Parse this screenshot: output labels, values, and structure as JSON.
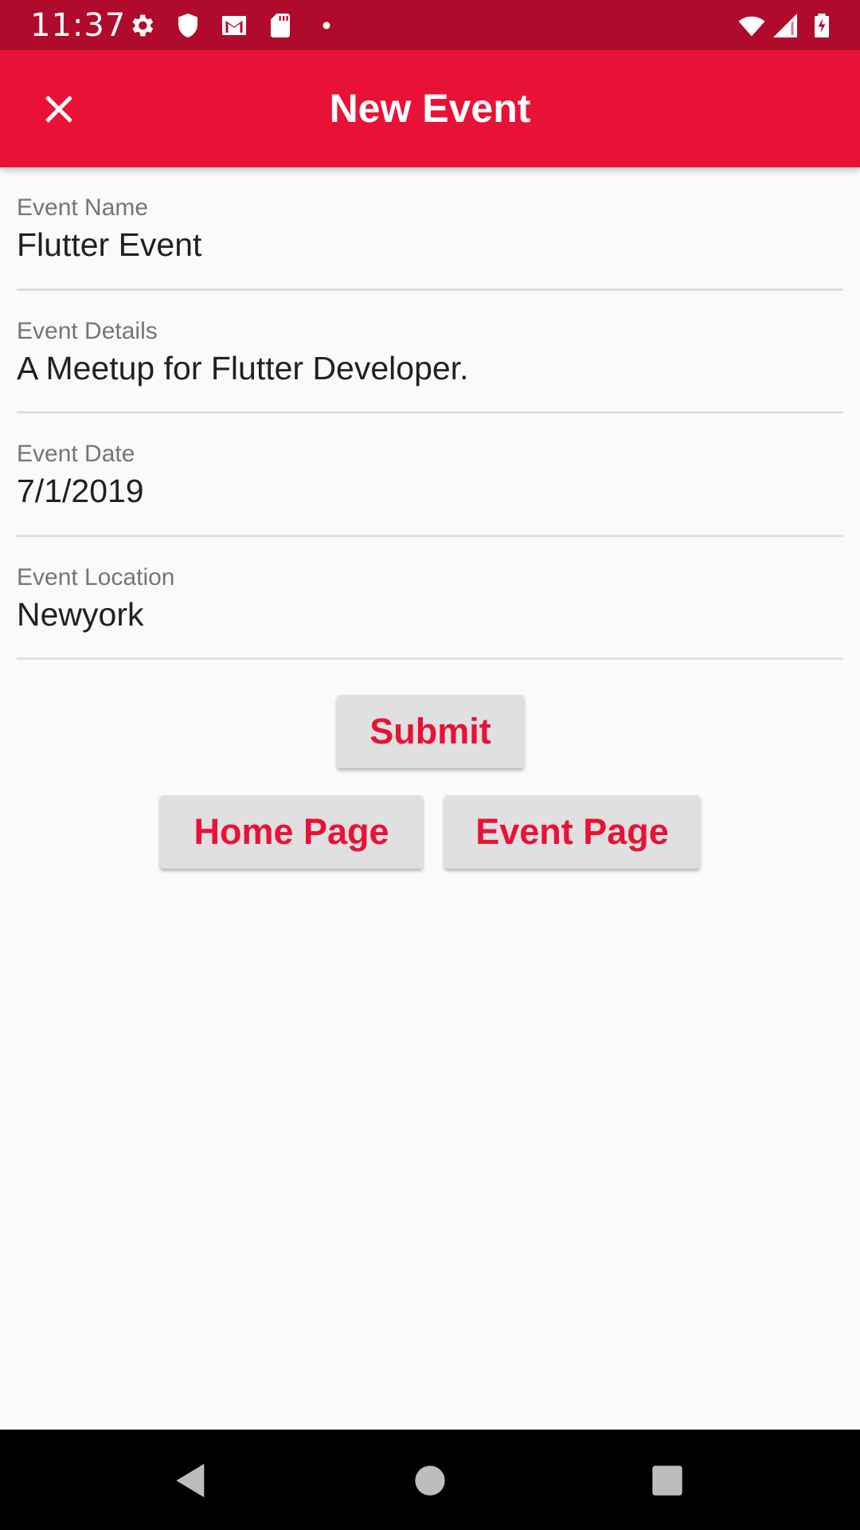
{
  "status_bar": {
    "time": "11:37",
    "icons_left": [
      "gear-icon",
      "shield-icon",
      "gmail-icon",
      "sd-card-icon",
      "dot-icon"
    ],
    "icons_right": [
      "wifi-icon",
      "signal-icon",
      "battery-charging-icon"
    ]
  },
  "app_bar": {
    "title": "New Event",
    "close_icon": "close-icon",
    "color": "#e81237"
  },
  "form": {
    "fields": [
      {
        "label": "Event Name",
        "value": "Flutter Event"
      },
      {
        "label": "Event Details",
        "value": "A Meetup for Flutter Developer."
      },
      {
        "label": "Event Date",
        "value": "7/1/2019"
      },
      {
        "label": "Event Location",
        "value": "Newyork"
      }
    ]
  },
  "buttons": {
    "submit": "Submit",
    "home_page": "Home Page",
    "event_page": "Event Page"
  },
  "colors": {
    "status_bar": "#b00b2c",
    "accent": "#e81237",
    "button_bg": "#e0e0e0"
  },
  "nav_bar": {
    "icons": [
      "back-icon",
      "home-icon",
      "recents-icon"
    ]
  }
}
